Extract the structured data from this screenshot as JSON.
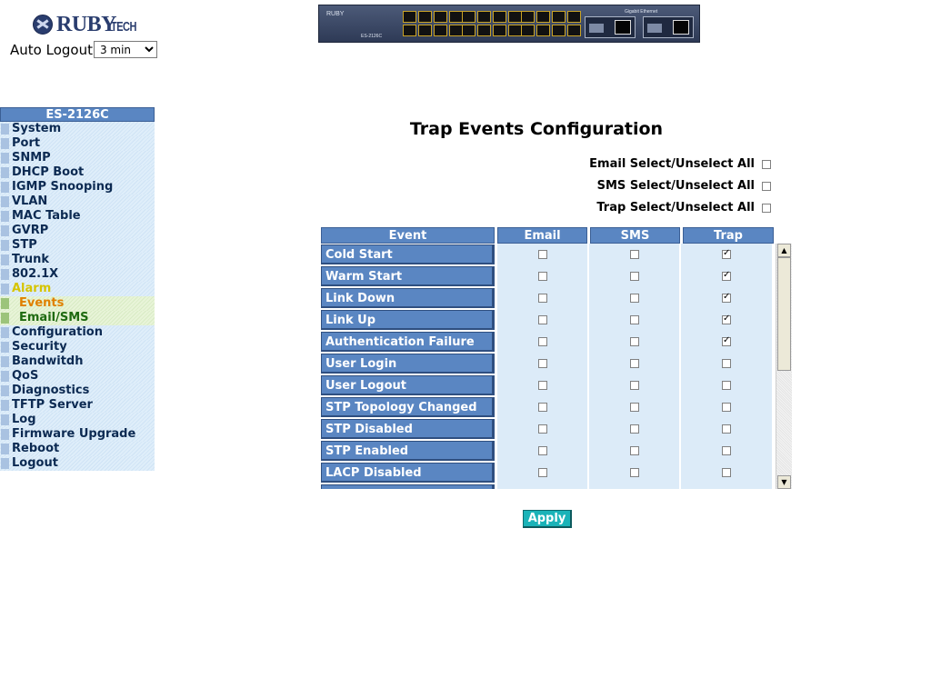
{
  "header": {
    "brand": "RUBY",
    "brand_tail": "TECH",
    "auto_logout_label": "Auto Logout",
    "auto_logout_value": "3 min",
    "device_logo": "RUBY",
    "device_model": "ES-2126C",
    "device_gbit_label": "Gigabit Ethernet"
  },
  "sidebar": {
    "model": "ES-2126C",
    "items": [
      {
        "label": "System"
      },
      {
        "label": "Port"
      },
      {
        "label": "SNMP"
      },
      {
        "label": "DHCP Boot"
      },
      {
        "label": "IGMP Snooping"
      },
      {
        "label": "VLAN"
      },
      {
        "label": "MAC Table"
      },
      {
        "label": "GVRP"
      },
      {
        "label": "STP"
      },
      {
        "label": "Trunk"
      },
      {
        "label": "802.1X"
      },
      {
        "label": "Alarm"
      },
      {
        "label": "Events"
      },
      {
        "label": "Email/SMS"
      },
      {
        "label": "Configuration"
      },
      {
        "label": "Security"
      },
      {
        "label": "Bandwitdh"
      },
      {
        "label": "QoS"
      },
      {
        "label": "Diagnostics"
      },
      {
        "label": "TFTP Server"
      },
      {
        "label": "Log"
      },
      {
        "label": "Firmware Upgrade"
      },
      {
        "label": "Reboot"
      },
      {
        "label": "Logout"
      }
    ]
  },
  "main": {
    "title": "Trap Events Configuration",
    "email_select_all": "Email Select/Unselect All",
    "sms_select_all": "SMS Select/Unselect All",
    "trap_select_all": "Trap Select/Unselect All",
    "columns": [
      "Event",
      "Email",
      "SMS",
      "Trap"
    ],
    "rows": [
      {
        "event": "Cold Start",
        "email": false,
        "sms": false,
        "trap": true
      },
      {
        "event": "Warm Start",
        "email": false,
        "sms": false,
        "trap": true
      },
      {
        "event": "Link Down",
        "email": false,
        "sms": false,
        "trap": true
      },
      {
        "event": "Link Up",
        "email": false,
        "sms": false,
        "trap": true
      },
      {
        "event": "Authentication Failure",
        "email": false,
        "sms": false,
        "trap": true
      },
      {
        "event": "User Login",
        "email": false,
        "sms": false,
        "trap": false
      },
      {
        "event": "User Logout",
        "email": false,
        "sms": false,
        "trap": false
      },
      {
        "event": "STP Topology Changed",
        "email": false,
        "sms": false,
        "trap": false
      },
      {
        "event": "STP Disabled",
        "email": false,
        "sms": false,
        "trap": false
      },
      {
        "event": "STP Enabled",
        "email": false,
        "sms": false,
        "trap": false
      },
      {
        "event": "LACP Disabled",
        "email": false,
        "sms": false,
        "trap": false
      }
    ],
    "apply_label": "Apply"
  }
}
